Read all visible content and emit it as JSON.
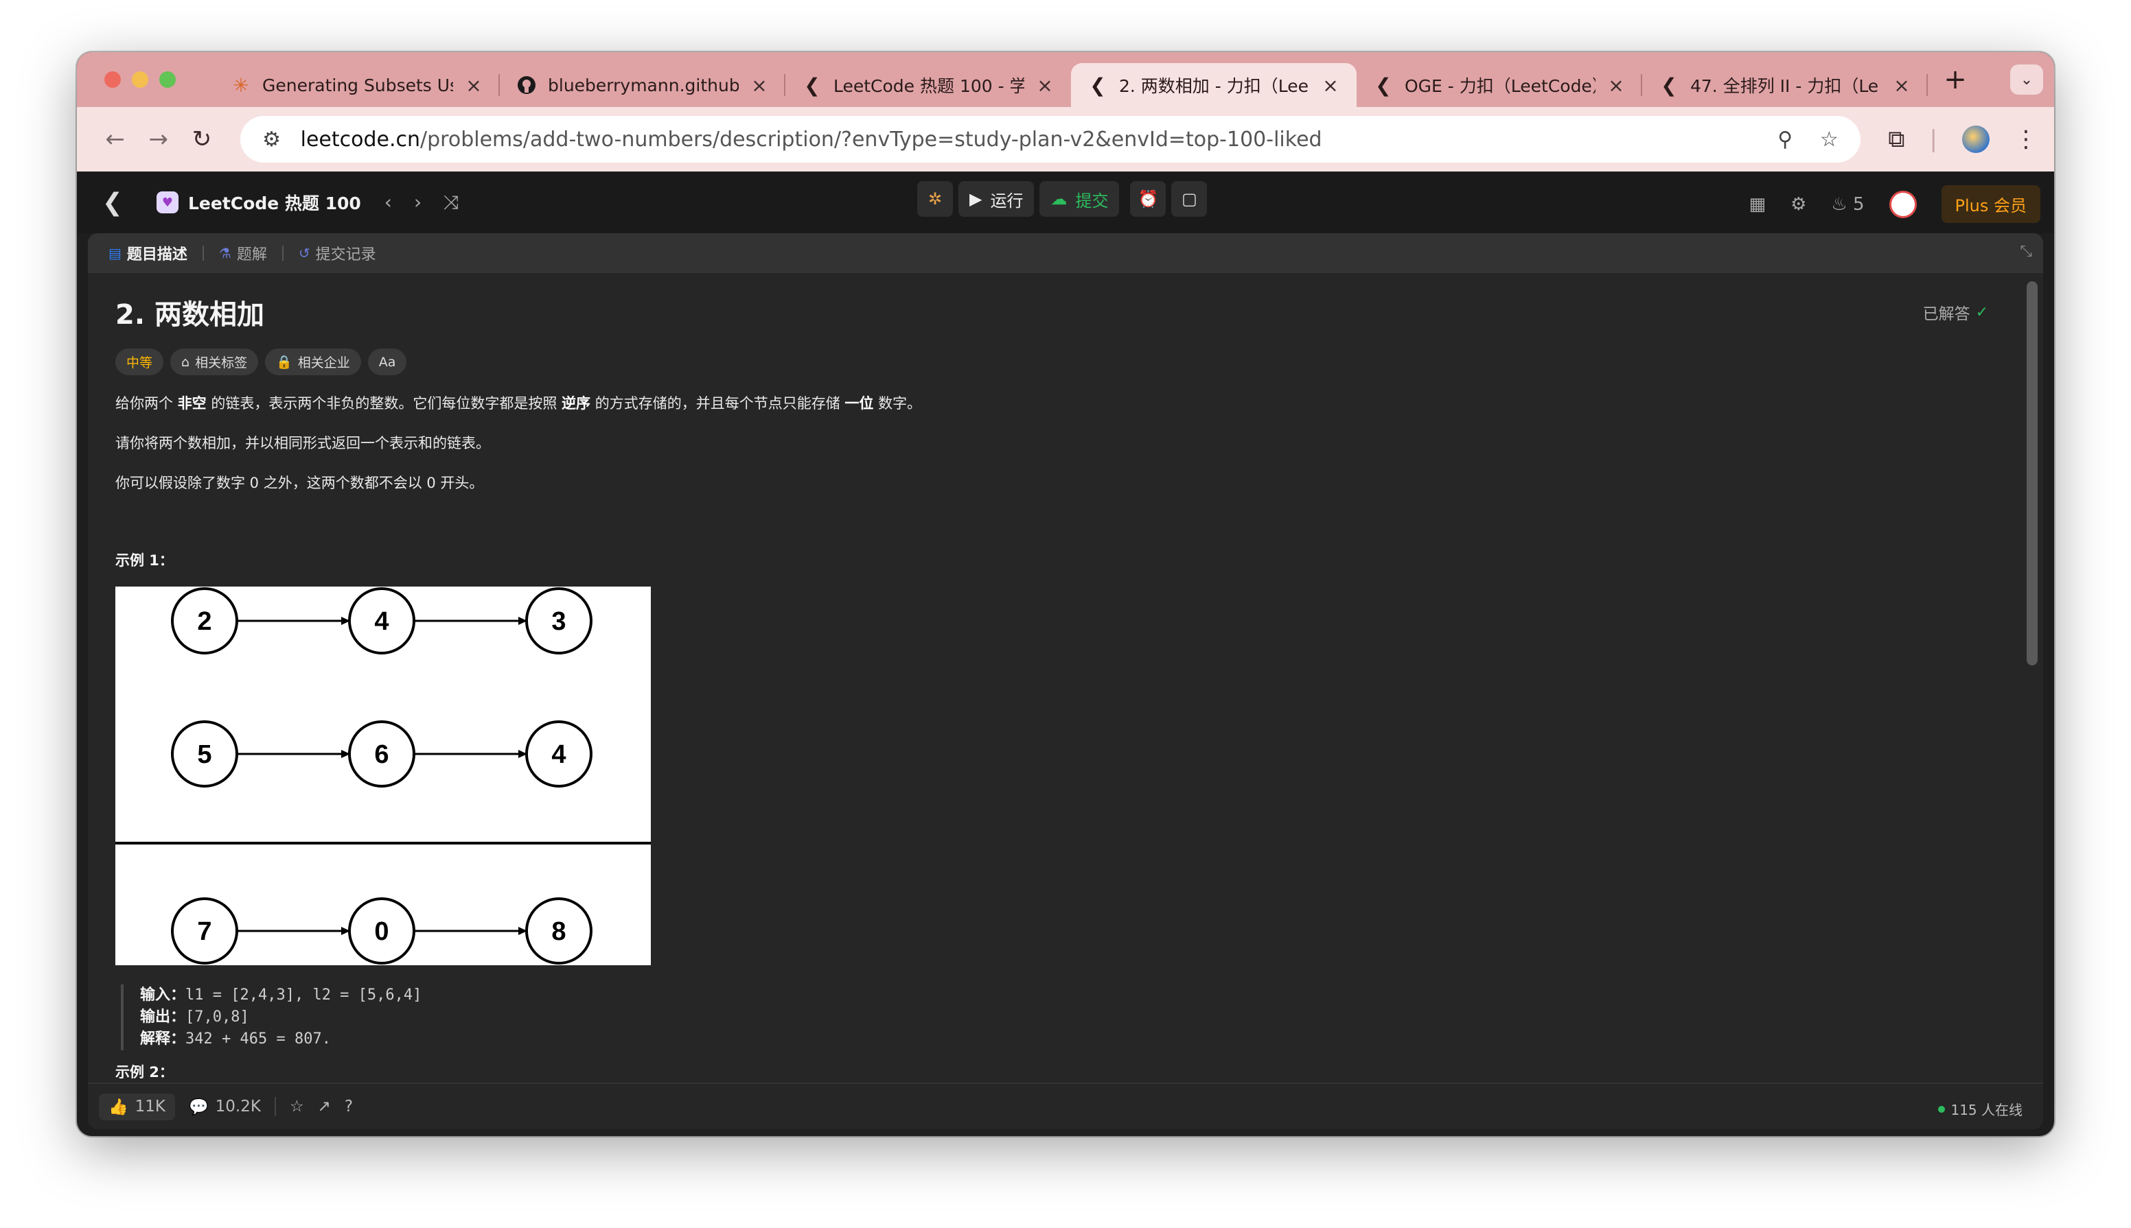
{
  "browser": {
    "tabs": [
      {
        "title": "Generating Subsets Usi",
        "icon": "asterisk-icon",
        "active": false
      },
      {
        "title": "blueberrymann.github.io",
        "icon": "github-icon",
        "active": false
      },
      {
        "title": "LeetCode 热题 100 - 学",
        "icon": "leetcode-icon",
        "active": false
      },
      {
        "title": "2. 两数相加 - 力扣（Lee",
        "icon": "leetcode-icon",
        "active": true
      },
      {
        "title": "OGE - 力扣（LeetCode）",
        "icon": "leetcode-icon",
        "active": false
      },
      {
        "title": "47. 全排列 II - 力扣（Le",
        "icon": "leetcode-icon",
        "active": false
      }
    ],
    "url_domain": "leetcode.cn",
    "url_path": "/problems/add-two-numbers/description/?envType=study-plan-v2&envId=top-100-liked"
  },
  "header": {
    "study_plan": "LeetCode 热题 100",
    "run_label": "运行",
    "submit_label": "提交",
    "streak": "5",
    "plus_label": "Plus 会员"
  },
  "panel": {
    "tabs": [
      "题目描述",
      "题解",
      "提交记录"
    ]
  },
  "problem": {
    "title": "2. 两数相加",
    "status": "已解答",
    "difficulty": "中等",
    "chip_tags": "相关标签",
    "chip_companies": "相关企业",
    "chip_font": "Aa",
    "desc1_a": "给你两个 ",
    "desc1_b": "非空",
    "desc1_c": " 的链表，表示两个非负的整数。它们每位数字都是按照 ",
    "desc1_d": "逆序",
    "desc1_e": " 的方式存储的，并且每个节点只能存储 ",
    "desc1_f": "一位",
    "desc1_g": " 数字。",
    "desc2": "请你将两个数相加，并以相同形式返回一个表示和的链表。",
    "desc3": "你可以假设除了数字 0 之外，这两个数都不会以 0 开头。",
    "example1_title": "示例 1：",
    "example1_input_label": "输入：",
    "example1_input": "l1 = [2,4,3], l2 = [5,6,4]",
    "example1_output_label": "输出：",
    "example1_output": "[7,0,8]",
    "example1_explain_label": "解释：",
    "example1_explain": "342 + 465 = 807.",
    "example2_title": "示例 2："
  },
  "diagram": {
    "rows": [
      [
        "2",
        "4",
        "3"
      ],
      [
        "5",
        "6",
        "4"
      ],
      [
        "7",
        "0",
        "8"
      ]
    ]
  },
  "footer": {
    "likes": "11K",
    "comments": "10.2K",
    "online": "115 人在线"
  }
}
